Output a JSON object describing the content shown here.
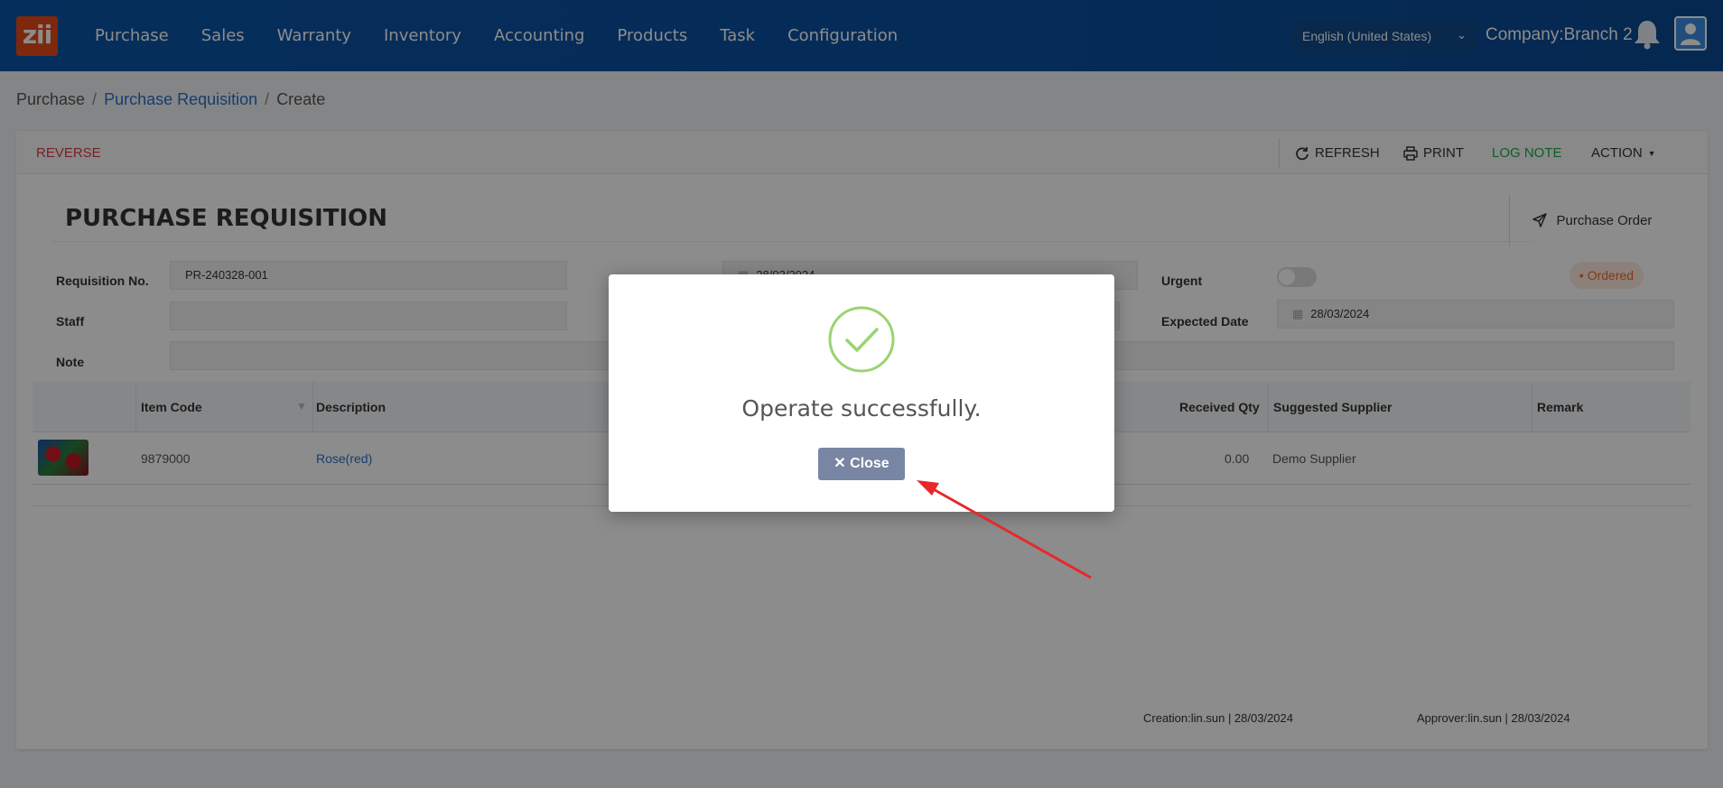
{
  "nav": {
    "logo": "zii",
    "items": [
      "Purchase",
      "Sales",
      "Warranty",
      "Inventory",
      "Accounting",
      "Products",
      "Task",
      "Configuration"
    ],
    "language": "English (United States)",
    "company": "Company:Branch 2"
  },
  "breadcrumb": [
    "Purchase",
    "/",
    "Purchase Requisition",
    "/",
    "Create"
  ],
  "toolbar": {
    "reverse": "REVERSE",
    "refresh": "REFRESH",
    "print": "PRINT",
    "log_note": "LOG NOTE",
    "action": "ACTION"
  },
  "form": {
    "title": "PURCHASE REQUISITION",
    "purchase_order_button": "Purchase Order",
    "requisition_no_label": "Requisition No.",
    "requisition_no_value": "PR-240328-001",
    "date_value": "28/03/2024",
    "staff_label": "Staff",
    "staff_value": "",
    "note_label": "Note",
    "note_value": "",
    "urgent_label": "Urgent",
    "expected_date_label": "Expected Date",
    "expected_date_value": "28/03/2024",
    "status": "• Ordered"
  },
  "table": {
    "columns": [
      "Item Code",
      "Description",
      "Received Qty",
      "Suggested Supplier",
      "Remark"
    ],
    "rows": [
      {
        "item_code": "9879000",
        "description": "Rose(red)",
        "received_qty": "0.00",
        "supplier": "Demo Supplier",
        "remark": ""
      }
    ]
  },
  "footer": {
    "creation": "Creation:lin.sun | 28/03/2024",
    "approver": "Approver:lin.sun | 28/03/2024"
  },
  "modal": {
    "message": "Operate successfully.",
    "close_label": "✕ Close"
  },
  "colors": {
    "nav_bg": "#0b55a8",
    "accent_link": "#2d6fc9",
    "reverse": "#d93a49",
    "log_note": "#1ea84c",
    "status": "#f06a28",
    "success": "#9ad46f",
    "close_button": "#7986a3",
    "annotation_arrow": "#e8282b"
  }
}
